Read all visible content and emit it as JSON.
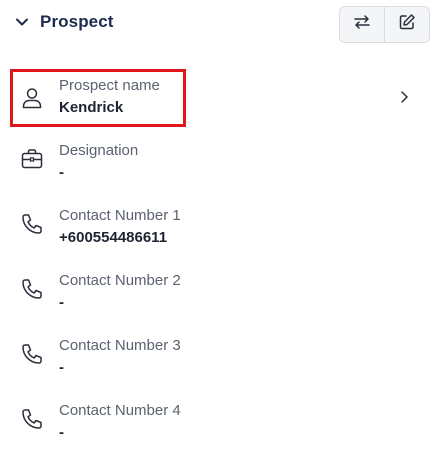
{
  "section": {
    "title": "Prospect",
    "toggle_icon": "chevron-down-icon"
  },
  "toolbar": {
    "buttons": [
      {
        "name": "swap-button",
        "icon": "swap-arrows-icon"
      },
      {
        "name": "edit-button",
        "icon": "edit-pencil-icon"
      }
    ]
  },
  "fields": [
    {
      "label": "Prospect name",
      "value": "Kendrick",
      "icon": "person-icon",
      "highlighted": true,
      "has_chevron": true
    },
    {
      "label": "Designation",
      "value": "-",
      "icon": "briefcase-icon"
    },
    {
      "label": "Contact Number 1",
      "value": "+600554486611",
      "icon": "phone-icon"
    },
    {
      "label": "Contact Number 2",
      "value": "-",
      "icon": "phone-icon"
    },
    {
      "label": "Contact Number 3",
      "value": "-",
      "icon": "phone-icon"
    },
    {
      "label": "Contact Number 4",
      "value": "-",
      "icon": "phone-icon"
    }
  ],
  "colors": {
    "title": "#1d2b4f",
    "highlight": "#e0161d",
    "label": "#5b6270",
    "value": "#1f2430"
  }
}
